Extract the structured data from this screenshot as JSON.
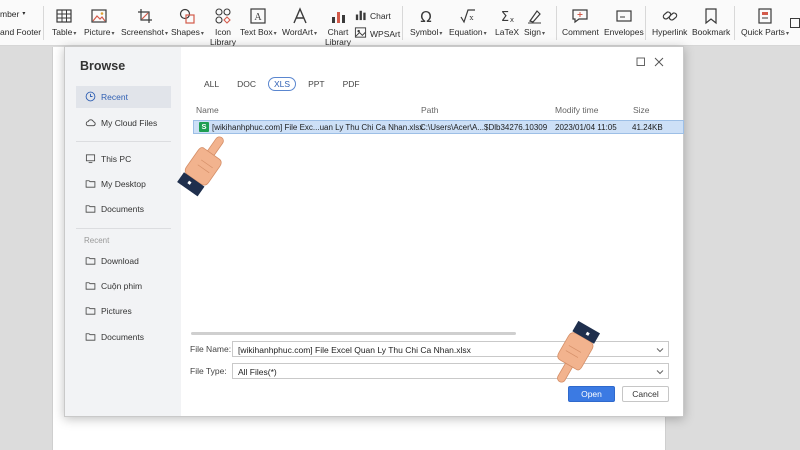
{
  "ribbon": {
    "partial_left_top": "mber",
    "partial_left_bottom": "and Footer",
    "items": [
      {
        "label": "Table",
        "icon": "table-icon"
      },
      {
        "label": "Picture",
        "icon": "picture-icon"
      },
      {
        "label": "Screenshot",
        "icon": "screenshot-icon"
      },
      {
        "label": "Shapes",
        "icon": "shapes-icon"
      },
      {
        "label": "Icon",
        "label2": "Library",
        "icon": "icon-library-icon"
      },
      {
        "label": "Text Box",
        "icon": "text-box-icon"
      },
      {
        "label": "WordArt",
        "icon": "wordart-icon"
      },
      {
        "label": "Chart",
        "label2": "Library",
        "icon": "chart-library-icon"
      },
      {
        "label": "Chart",
        "icon": "chart-icon"
      },
      {
        "label": "WPSArt",
        "icon": "wpsart-icon"
      },
      {
        "label": "Symbol",
        "icon": "symbol-icon"
      },
      {
        "label": "Equation",
        "icon": "equation-icon"
      },
      {
        "label": "LaTeX",
        "icon": "latex-icon"
      },
      {
        "label": "Sign",
        "icon": "sign-icon"
      },
      {
        "label": "Comment",
        "icon": "comment-icon"
      },
      {
        "label": "Envelopes",
        "icon": "envelopes-icon"
      },
      {
        "label": "Hyperlink",
        "icon": "hyperlink-icon"
      },
      {
        "label": "Bookmark",
        "icon": "bookmark-icon"
      },
      {
        "label": "Quick Parts",
        "icon": "quick-parts-icon"
      }
    ]
  },
  "dialog": {
    "title": "Browse",
    "nav_primary": [
      {
        "label": "Recent",
        "icon": "clock-icon",
        "active": true
      },
      {
        "label": "My Cloud Files",
        "icon": "cloud-icon",
        "active": false
      }
    ],
    "nav_places": [
      {
        "label": "This PC",
        "icon": "monitor-icon"
      },
      {
        "label": "My Desktop",
        "icon": "folder-icon"
      },
      {
        "label": "Documents",
        "icon": "folder-icon"
      }
    ],
    "recent_section_label": "Recent",
    "nav_recent": [
      {
        "label": "Download",
        "icon": "folder-icon"
      },
      {
        "label": "Cuộn phim",
        "icon": "folder-icon"
      },
      {
        "label": "Pictures",
        "icon": "folder-icon"
      },
      {
        "label": "Documents",
        "icon": "folder-icon"
      }
    ],
    "filter_tabs": [
      {
        "label": "ALL",
        "active": false
      },
      {
        "label": "DOC",
        "active": false
      },
      {
        "label": "XLS",
        "active": true
      },
      {
        "label": "PPT",
        "active": false
      },
      {
        "label": "PDF",
        "active": false
      }
    ],
    "columns": {
      "name": "Name",
      "path": "Path",
      "modified": "Modify time",
      "size": "Size"
    },
    "files": [
      {
        "badge": "S",
        "name": "[wikihanhphuc.com] File Exc...uan Ly Thu Chi Ca Nhan.xlsx",
        "path": "C:\\Users\\Acer\\A...$Dlb34276.10309",
        "modified": "2023/01/04 11:05",
        "size": "41.24KB"
      }
    ],
    "file_name_label": "File Name:",
    "file_name_value": "[wikihanhphuc.com] File Excel Quan Ly Thu Chi Ca Nhan.xlsx",
    "file_type_label": "File Type:",
    "file_type_value": "All Files(*)",
    "open_label": "Open",
    "cancel_label": "Cancel"
  },
  "colors": {
    "accent": "#3b7ae3",
    "selection": "#cde0f7",
    "excel_green": "#1e9e52",
    "sidebar": "#f2f3f5"
  }
}
